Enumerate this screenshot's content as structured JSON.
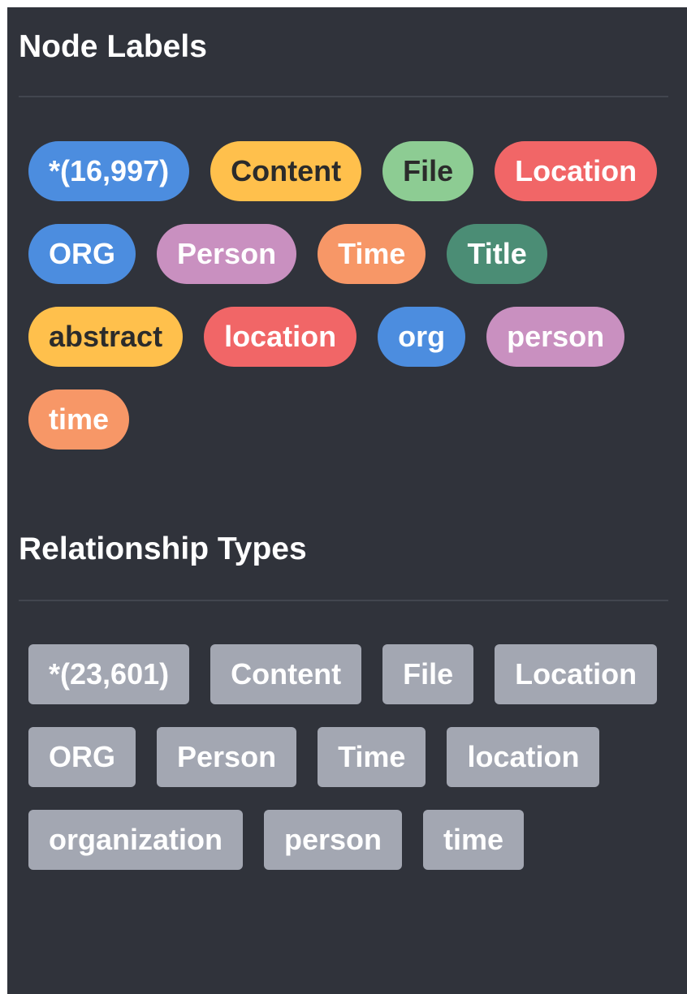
{
  "node_labels": {
    "title": "Node Labels",
    "chips": [
      {
        "label": "*(16,997)",
        "bg": "#4c8ddf",
        "fg": "#ffffff"
      },
      {
        "label": "Content",
        "bg": "#ffc04c",
        "fg": "#2b2b2b"
      },
      {
        "label": "File",
        "bg": "#8dcc93",
        "fg": "#2b2b2b"
      },
      {
        "label": "Location",
        "bg": "#f16667",
        "fg": "#ffffff"
      },
      {
        "label": "ORG",
        "bg": "#4c8ddf",
        "fg": "#ffffff"
      },
      {
        "label": "Person",
        "bg": "#c990c0",
        "fg": "#ffffff"
      },
      {
        "label": "Time",
        "bg": "#f79767",
        "fg": "#ffffff"
      },
      {
        "label": "Title",
        "bg": "#4b8d75",
        "fg": "#ffffff"
      },
      {
        "label": "abstract",
        "bg": "#ffc04c",
        "fg": "#2b2b2b"
      },
      {
        "label": "location",
        "bg": "#f16667",
        "fg": "#ffffff"
      },
      {
        "label": "org",
        "bg": "#4c8ddf",
        "fg": "#ffffff"
      },
      {
        "label": "person",
        "bg": "#c990c0",
        "fg": "#ffffff"
      },
      {
        "label": "time",
        "bg": "#f79767",
        "fg": "#ffffff"
      }
    ]
  },
  "relationship_types": {
    "title": "Relationship Types",
    "chip_bg": "#a3a7b2",
    "chip_fg": "#ffffff",
    "chips": [
      {
        "label": "*(23,601)"
      },
      {
        "label": "Content"
      },
      {
        "label": "File"
      },
      {
        "label": "Location"
      },
      {
        "label": "ORG"
      },
      {
        "label": "Person"
      },
      {
        "label": "Time"
      },
      {
        "label": "location"
      },
      {
        "label": "organization"
      },
      {
        "label": "person"
      },
      {
        "label": "time"
      }
    ]
  }
}
